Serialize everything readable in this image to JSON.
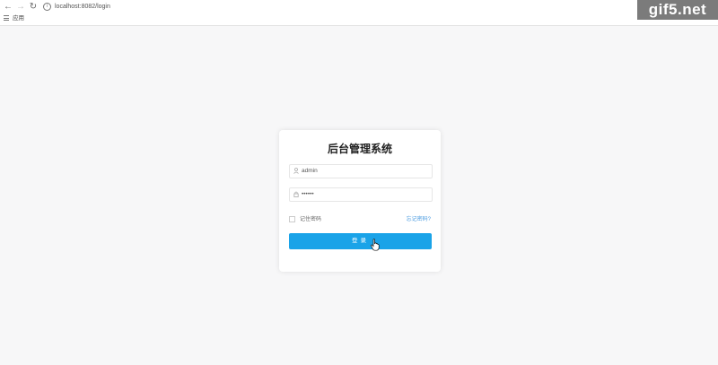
{
  "browser": {
    "url": "localhost:8082/login",
    "bookmarks_label": "应用"
  },
  "watermark": "gif5.net",
  "login": {
    "title": "后台管理系统",
    "username_value": "admin",
    "password_value": "••••••",
    "remember_label": "记住密码",
    "forgot_label": "忘记密码?",
    "submit_label": "登录"
  },
  "colors": {
    "primary": "#1aa3e8",
    "link": "#4a9be0",
    "background": "#f7f7f8"
  }
}
